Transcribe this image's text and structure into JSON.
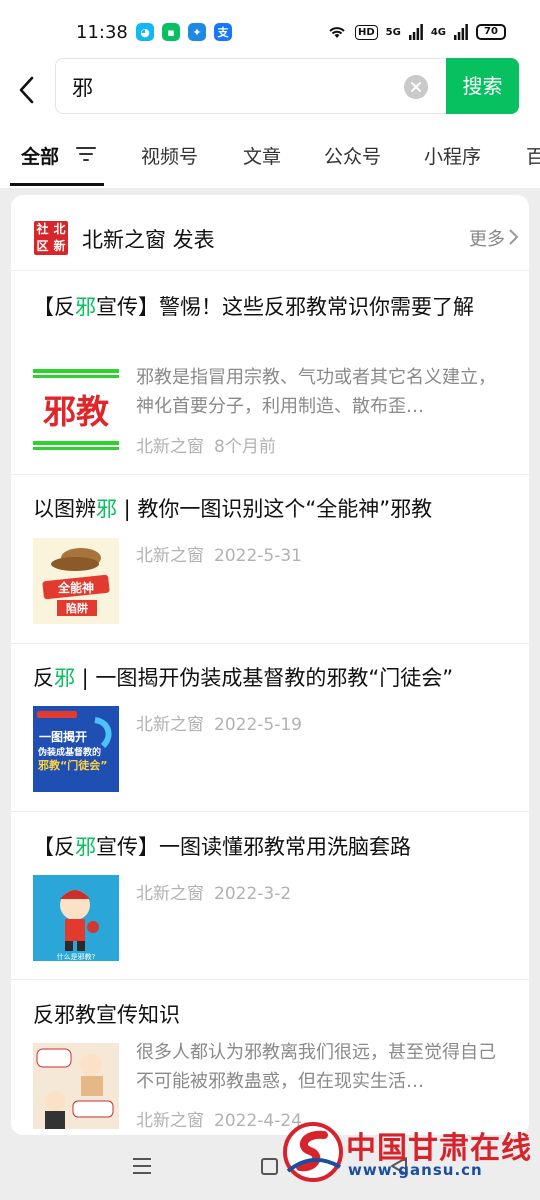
{
  "status_bar": {
    "time": "11:38",
    "hd": "HD",
    "sig1": "5G",
    "sig2": "4G",
    "battery": "70"
  },
  "search": {
    "query": "邪",
    "button": "搜索"
  },
  "tabs": [
    {
      "label": "全部"
    },
    {
      "label": "视频号"
    },
    {
      "label": "文章"
    },
    {
      "label": "公众号"
    },
    {
      "label": "小程序"
    },
    {
      "label": "百"
    }
  ],
  "account": {
    "logo_chars": [
      "社",
      "北",
      "区",
      "新"
    ],
    "title": "北新之窗 发表",
    "more": "更多"
  },
  "articles": [
    {
      "title_parts": [
        "【反",
        "邪",
        "宣传】警惕！这些反邪教常识你需要了解"
      ],
      "thumb_text": "邪教",
      "summary": "邪教是指冒用宗教、气功或者其它名义建立，神化首要分子，利用制造、散布歪…",
      "source": "北新之窗",
      "date": "8个月前"
    },
    {
      "title_parts": [
        "以图辨",
        "邪",
        " | 教你一图识别这个“全能神”邪教"
      ],
      "thumb_text": "全能神 陷阱",
      "source": "北新之窗",
      "date": "2022-5-31"
    },
    {
      "title_parts": [
        "反",
        "邪",
        " | 一图揭开伪装成基督教的邪教“门徒会”"
      ],
      "thumb_text": "一图揭开 伪装成基督教的 邪教“门徒会”",
      "source": "北新之窗",
      "date": "2022-5-19"
    },
    {
      "title_parts": [
        "【反",
        "邪",
        "宣传】一图读懂邪教常用洗脑套路"
      ],
      "thumb_text": "什么是邪教?",
      "source": "北新之窗",
      "date": "2022-3-2"
    },
    {
      "title_parts": [
        "反邪教宣传知识",
        "",
        ""
      ],
      "summary": "很多人都认为邪教离我们很远，甚至觉得自己不可能被邪教蛊惑，但在现实生活…",
      "source": "北新之窗",
      "date": "2022-4-24"
    }
  ],
  "watermark": {
    "text": "中国甘肃在线",
    "url": "www.gansu.cn"
  },
  "colors": {
    "accent": "#07c160",
    "watermark_red": "#d6232c",
    "watermark_blue": "#1b4ea0"
  }
}
